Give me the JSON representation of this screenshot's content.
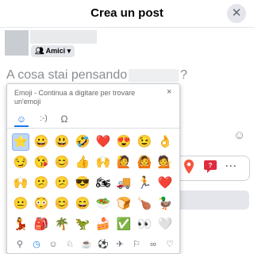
{
  "header": {
    "title": "Crea un post",
    "close": "✕"
  },
  "audience": {
    "label": "Amici",
    "icon": "people-icon",
    "caret": "▾"
  },
  "composer": {
    "prompt_start": "A cosa stai pensando",
    "prompt_end": "?"
  },
  "emoji_picker": {
    "title": "Emoji - Continua a digitare per trovare un'emoji",
    "close": "×",
    "tabs": [
      {
        "icon": "smiley-tab-icon",
        "glyph": "☺"
      },
      {
        "icon": "text-emoticon-tab-icon",
        "glyph": ":-)"
      },
      {
        "icon": "omega-tab-icon",
        "glyph": "Ω"
      }
    ],
    "rows": [
      [
        "⭐",
        "😀",
        "😃",
        "🤣",
        "❤️",
        "😍",
        "😉",
        "👌"
      ],
      [
        "😏",
        "😘",
        "😊",
        "👍",
        "🙌",
        "🙋",
        "🙆",
        "💁"
      ],
      [
        "🙌",
        "😕",
        "😕",
        "😎",
        "🏍",
        "🚚",
        "🏃",
        "❤️"
      ],
      [
        "😐",
        "😳",
        "😊",
        "😄",
        "🥗",
        "🍞",
        "🍗",
        "🦆"
      ],
      [
        "💃",
        "🎒",
        "🌴",
        "🦖",
        "🍰",
        "✅",
        "👀",
        "🤍"
      ]
    ],
    "categories": [
      {
        "icon": "search-icon",
        "glyph": "⚲"
      },
      {
        "icon": "recent-clock-icon",
        "glyph": "◷"
      },
      {
        "icon": "smileys-category-icon",
        "glyph": "☺"
      },
      {
        "icon": "animals-category-icon",
        "glyph": "♘"
      },
      {
        "icon": "food-category-icon",
        "glyph": "☕"
      },
      {
        "icon": "activity-category-icon",
        "glyph": "⚽"
      },
      {
        "icon": "travel-category-icon",
        "glyph": "✈"
      },
      {
        "icon": "objects-category-icon",
        "glyph": "⚐"
      },
      {
        "icon": "symbols-category-icon",
        "glyph": "∞"
      },
      {
        "icon": "heart-category-icon",
        "glyph": "♡"
      }
    ]
  },
  "actions": {
    "location_icon": "location-pin-icon",
    "gif_icon": "gif-icon",
    "more": "···"
  },
  "colors": {
    "accent": "#1877f2",
    "pin": "#f5533d",
    "gif": "#e02b3e"
  }
}
